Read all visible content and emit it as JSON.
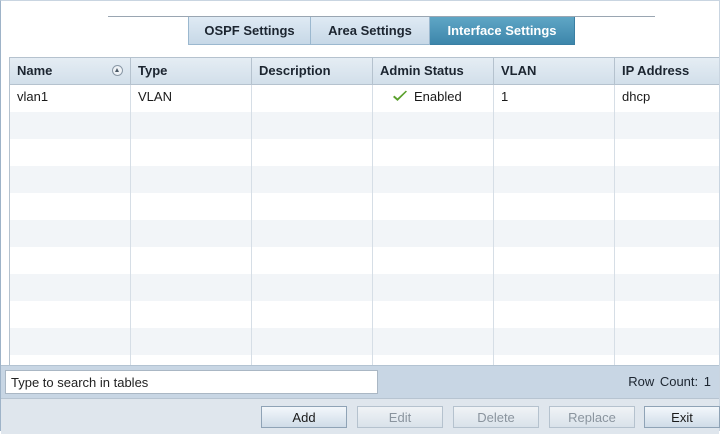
{
  "tabs": [
    {
      "label": "OSPF Settings",
      "active": false
    },
    {
      "label": "Area Settings",
      "active": false
    },
    {
      "label": "Interface Settings",
      "active": true
    }
  ],
  "table": {
    "columns": [
      "Name",
      "Type",
      "Description",
      "Admin Status",
      "VLAN",
      "IP Address"
    ],
    "sort_icon": "sort-ascending-icon",
    "rows": [
      {
        "name": "vlan1",
        "type": "VLAN",
        "description": "",
        "admin_status": "Enabled",
        "status_icon": "check-icon",
        "vlan": "1",
        "ip_address": "dhcp"
      }
    ]
  },
  "search": {
    "placeholder": "Type to search in tables",
    "value": ""
  },
  "row_count": {
    "label": "Row Count:",
    "value": "1"
  },
  "buttons": {
    "add": "Add",
    "edit": "Edit",
    "delete": "Delete",
    "replace": "Replace",
    "exit": "Exit"
  },
  "colors": {
    "accent_tab": "#3d86ab",
    "check": "#5aa02c",
    "footer": "#c8d6e4"
  }
}
